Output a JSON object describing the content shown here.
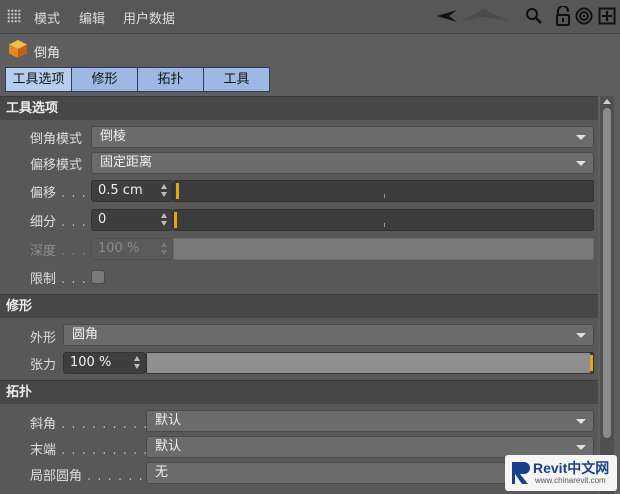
{
  "menubar": {
    "items": [
      "模式",
      "编辑",
      "用户数据"
    ],
    "icons": [
      "arrow-left-icon",
      "arrow-up-icon",
      "search-icon",
      "lock-icon",
      "target-icon",
      "add-panel-icon"
    ]
  },
  "title": {
    "text": "倒角",
    "icon": "bevel-cube-icon"
  },
  "tabs": [
    {
      "label": "工具选项",
      "active": true
    },
    {
      "label": "修形",
      "active": false
    },
    {
      "label": "拓扑",
      "active": false
    },
    {
      "label": "工具",
      "active": false
    }
  ],
  "tool_options": {
    "header": "工具选项",
    "bevel_mode": {
      "label": "倒角模式",
      "value": "倒棱"
    },
    "offset_mode": {
      "label": "偏移模式",
      "value": "固定距离"
    },
    "offset": {
      "label": "偏移",
      "dots": " . . .",
      "value": "0.5 cm",
      "slider_fraction": 0.005
    },
    "subdivision": {
      "label": "细分",
      "dots": " . . .",
      "value": "0",
      "slider_fraction": 0
    },
    "depth": {
      "label": "深度",
      "dots": " . . .",
      "value": "100 %",
      "enabled": false
    },
    "limit": {
      "label": "限制",
      "dots": " . . .",
      "checked": false
    }
  },
  "shaping": {
    "header": "修形",
    "shape": {
      "label": "外形",
      "value": "圆角"
    },
    "tension": {
      "label": "张力",
      "value": "100 %",
      "slider_fraction": 1.0
    }
  },
  "topology": {
    "header": "拓扑",
    "miter": {
      "label": "斜角",
      "dots": " . . . . . . . . . .",
      "value": "默认"
    },
    "end": {
      "label": "末端",
      "dots": " . . . . . . . . . .",
      "value": "默认"
    },
    "partial_rounding": {
      "label": "局部圆角",
      "dots": " . . . . . . .",
      "value": "无"
    }
  },
  "watermark": {
    "title": "Revit中文网",
    "url": "www.chinarevit.com"
  },
  "colors": {
    "accent_handle": "#e8a21a",
    "tab_bg": "#9db8e2",
    "section_bg": "#474747"
  }
}
